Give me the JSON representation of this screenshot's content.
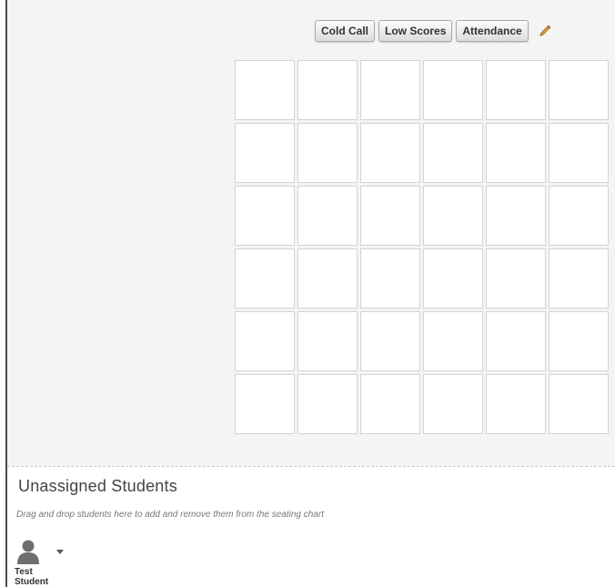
{
  "toolbar": {
    "cold_call_label": "Cold Call",
    "low_scores_label": "Low Scores",
    "attendance_label": "Attendance",
    "edit_icon": "pencil-icon"
  },
  "seating_chart": {
    "rows": 6,
    "columns": 6
  },
  "unassigned": {
    "title": "Unassigned Students",
    "help_text": "Drag and drop students here to add and remove them from the seating chart",
    "students": [
      {
        "name": "Test Student",
        "avatar_icon": "user-silhouette-icon",
        "menu_icon": "caret-down-icon"
      }
    ]
  },
  "colors": {
    "chart_background": "#f4f4f4",
    "seat_border": "#d3d3d3",
    "accent_pencil": "#e0a030"
  }
}
